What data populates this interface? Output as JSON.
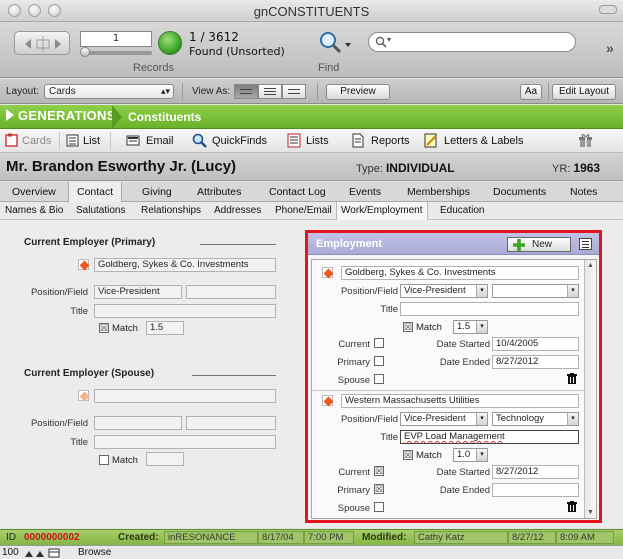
{
  "window": {
    "title": "gnCONSTITUENTS"
  },
  "toolbar": {
    "record_number": "1",
    "record_count": "1 / 3612",
    "found_state": "Found (Unsorted)",
    "records_label": "Records",
    "find_label": "Find",
    "search_placeholder": ""
  },
  "layoutbar": {
    "layout_label": "Layout:",
    "layout_value": "Cards",
    "view_as_label": "View As:",
    "preview_label": "Preview",
    "text_format_label": "Aa",
    "edit_layout_label": "Edit Layout"
  },
  "header": {
    "brand": "GENERATIONS",
    "module": "Constituents"
  },
  "menu": {
    "items": [
      "Cards",
      "List",
      "Email",
      "QuickFinds",
      "Lists",
      "Reports",
      "Letters & Labels"
    ]
  },
  "person": {
    "name": "Mr. Brandon Esworthy Jr. (Lucy)",
    "type_label": "Type:",
    "type_value": "INDIVIDUAL",
    "year_label": "YR:",
    "year_value": "1963"
  },
  "tabs": {
    "primary": [
      "Overview",
      "Contact",
      "Giving",
      "Attributes",
      "Contact Log",
      "Events",
      "Memberships",
      "Documents",
      "Notes"
    ],
    "primary_active": "Contact",
    "secondary": [
      "Names & Bio",
      "Salutations",
      "Relationships",
      "Addresses",
      "Phone/Email",
      "Work/Employment",
      "Education"
    ],
    "secondary_active": "Work/Employment"
  },
  "left": {
    "primary": {
      "heading": "Current Employer (Primary)",
      "employer": "Goldberg, Sykes & Co. Investments",
      "position_label": "Position/Field",
      "position": "Vice-President",
      "field": "",
      "title_label": "Title",
      "title": "",
      "match_label": "Match",
      "match_checked": "☒",
      "match_value": "1.5"
    },
    "spouse": {
      "heading": "Current Employer (Spouse)",
      "employer": "",
      "position_label": "Position/Field",
      "position": "",
      "field": "",
      "title_label": "Title",
      "title": "",
      "match_label": "Match",
      "match_checked": "",
      "match_value": ""
    }
  },
  "employment": {
    "title": "Employment",
    "new_label": "New",
    "labels": {
      "position": "Position/Field",
      "title": "Title",
      "match": "Match",
      "current": "Current",
      "primary": "Primary",
      "spouse": "Spouse",
      "date_started": "Date Started",
      "date_ended": "Date Ended"
    },
    "rows": [
      {
        "employer": "Goldberg, Sykes & Co. Investments",
        "position": "Vice-President",
        "field": "",
        "title": "",
        "match_checked": "☒",
        "match": "1.5",
        "current": "",
        "primary": "",
        "spouse": "",
        "date_started": "10/4/2005",
        "date_ended": "8/27/2012"
      },
      {
        "employer": "Western Massachusetts Utilities",
        "position": "Vice-President",
        "field": "Technology",
        "title": "EVP Load Management",
        "match_checked": "☒",
        "match": "1.0",
        "current": "☒",
        "primary": "☒",
        "spouse": "",
        "date_started": "8/27/2012",
        "date_ended": ""
      }
    ]
  },
  "status": {
    "id_label": "ID",
    "id_value": "0000000002",
    "created_label": "Created:",
    "created_by": "inRESONANCE",
    "created_date": "8/17/04",
    "created_time": "7:00 PM",
    "modified_label": "Modified:",
    "modified_by": "Cathy Katz",
    "modified_date": "8/27/12",
    "modified_time": "8:09 AM"
  },
  "bottom": {
    "zoom": "100",
    "mode": "Browse"
  },
  "colors": {
    "brand_green": "#7cc03a",
    "panel_header": "#b3b5de",
    "highlight_red": "#e3161f",
    "status_green": "#97c257",
    "diamond_orange": "#e85a1c",
    "id_red": "#c41616"
  }
}
